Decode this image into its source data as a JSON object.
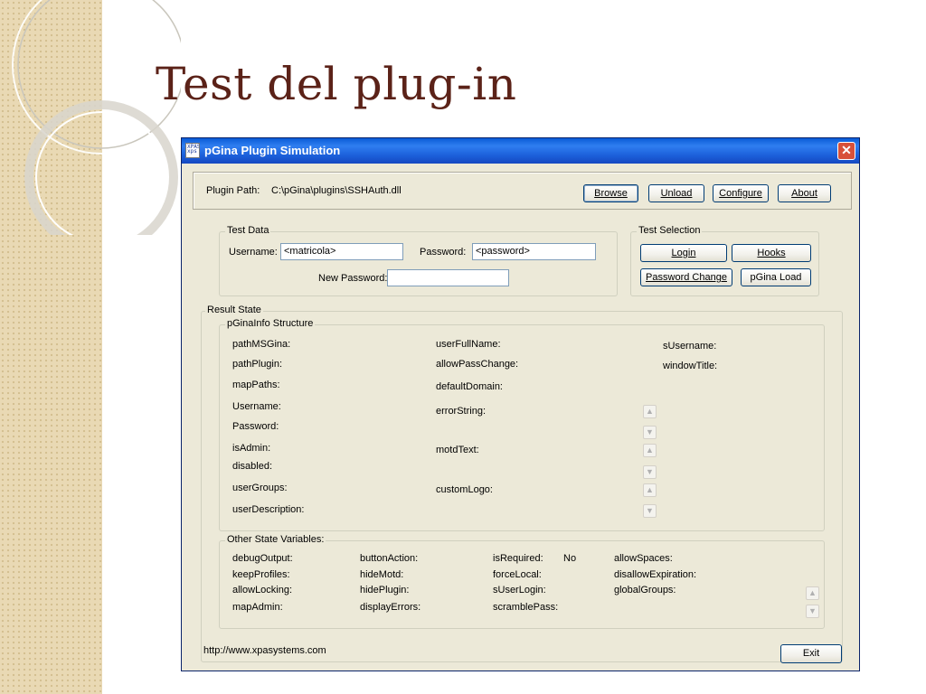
{
  "slide": {
    "title": "Test del plug-in"
  },
  "window": {
    "title": "pGina Plugin Simulation",
    "icon_text": "XPAS\nxps",
    "close_glyph": "✕"
  },
  "plugin": {
    "path_label": "Plugin Path:",
    "path_value": "C:\\pGina\\plugins\\SSHAuth.dll",
    "buttons": {
      "browse": "Browse",
      "unload": "Unload",
      "configure": "Configure",
      "about": "About"
    }
  },
  "test_data": {
    "legend": "Test Data",
    "username_label": "Username:",
    "username_value": "<matricola>",
    "password_label": "Password:",
    "password_value": "<password>",
    "new_password_label": "New Password:",
    "new_password_value": ""
  },
  "test_selection": {
    "legend": "Test Selection",
    "login": "Login",
    "hooks": "Hooks",
    "password_change": "Password Change",
    "pgina_load": "pGina Load"
  },
  "result_state": {
    "legend": "Result State",
    "pginainfo_legend": "pGinaInfo Structure",
    "col1": [
      "pathMSGina:",
      "pathPlugin:",
      "mapPaths:",
      "Username:",
      "Password:",
      "isAdmin:",
      "disabled:",
      "userGroups:",
      "userDescription:"
    ],
    "col2": [
      "userFullName:",
      "allowPassChange:",
      "defaultDomain:",
      "errorString:",
      "motdText:",
      "customLogo:"
    ],
    "col3": [
      "sUsername:",
      "windowTitle:"
    ]
  },
  "other_state": {
    "legend": "Other State Variables:",
    "col1": [
      "debugOutput:",
      "keepProfiles:",
      "allowLocking:",
      "mapAdmin:"
    ],
    "col2": [
      "buttonAction:",
      "hideMotd:",
      "hidePlugin:",
      "displayErrors:"
    ],
    "col3": [
      "isRequired:",
      "forceLocal:",
      "sUserLogin:",
      "scramblePass:"
    ],
    "isrequired_value": "No",
    "col4": [
      "allowSpaces:",
      "disallowExpiration:",
      "globalGroups:"
    ]
  },
  "footer": {
    "url": "http://www.xpasystems.com",
    "exit": "Exit"
  },
  "colors": {
    "title_text": "#5b2218",
    "titlebar": "#1b5ed9",
    "window_bg": "#ece9d8"
  },
  "icons": {
    "scroll_up": "▲",
    "scroll_down": "▼"
  }
}
